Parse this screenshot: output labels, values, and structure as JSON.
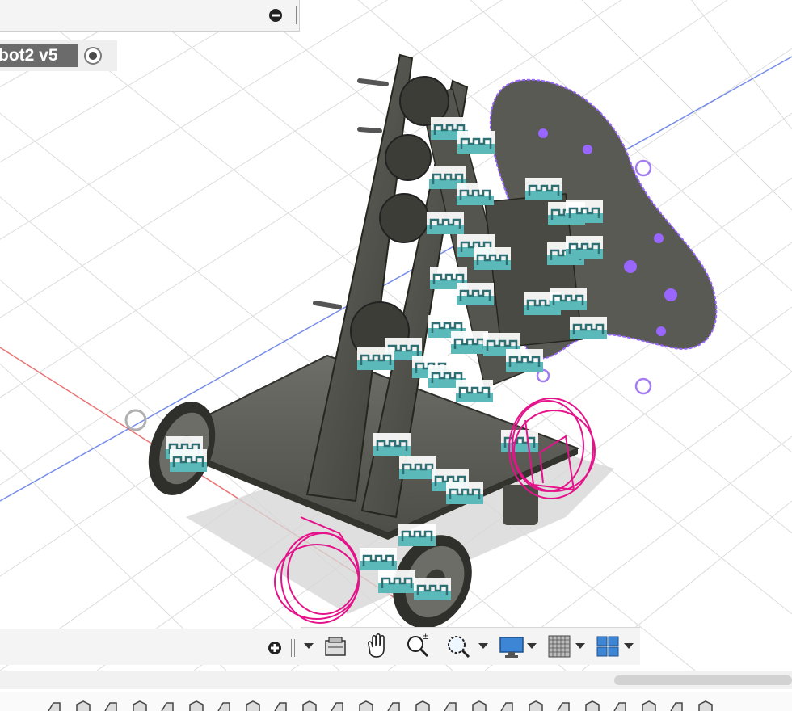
{
  "browser": {
    "title": "bot2 v5"
  },
  "panels": {
    "top_collapse_icon": "minus-circle-icon",
    "bottom_expand_icon": "plus-circle-icon"
  },
  "navigation_toolbar": {
    "tools": [
      {
        "name": "look-at-icon"
      },
      {
        "name": "pan-icon"
      },
      {
        "name": "zoom-icon"
      },
      {
        "name": "fit-icon"
      },
      {
        "name": "display-settings-icon"
      },
      {
        "name": "grid-snaps-icon"
      },
      {
        "name": "viewports-icon"
      }
    ]
  },
  "timeline": {
    "feature_count": 24
  },
  "colors": {
    "annotation": "#e4138a",
    "constraint_marker": "#4fb3b3",
    "selection": "#9966ff",
    "x_axis": "#e03b3b",
    "y_axis": "#3d5ce0"
  }
}
